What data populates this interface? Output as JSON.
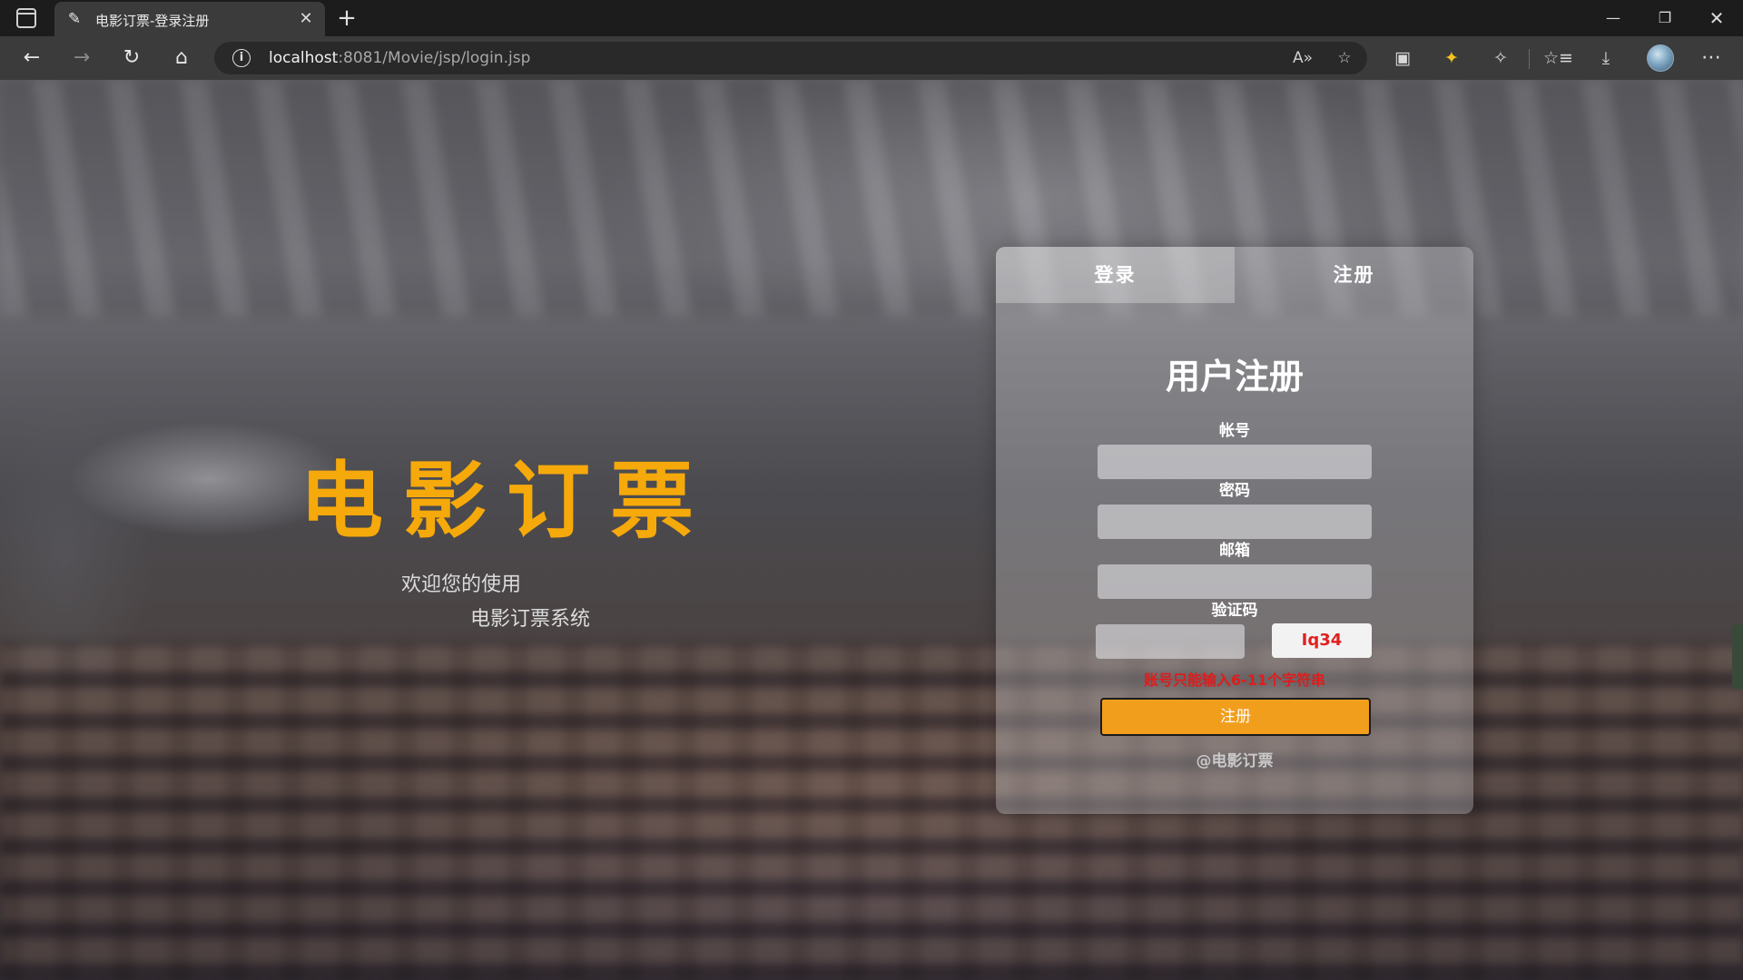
{
  "browser": {
    "tab_title": "电影订票-登录注册",
    "url_host": "localhost",
    "url_rest": ":8081/Movie/jsp/login.jsp",
    "icons": {
      "sidebar": "sidebar-toggle-icon",
      "favicon": "feather-pen-icon",
      "close": "✕",
      "new_tab": "+",
      "back": "←",
      "forward": "→",
      "refresh": "↻",
      "home": "⌂",
      "info": "i",
      "read_aloud": "A»",
      "add_favorite": "☆",
      "ext1": "▣",
      "ext2": "✦",
      "ext3": "✧",
      "favorites": "☆≡",
      "downloads": "⤓",
      "more": "⋯",
      "minimize": "—",
      "maximize": "❐",
      "win_close": "✕"
    }
  },
  "hero": {
    "title": "电影订票",
    "line1": "欢迎您的使用",
    "line2": "电影订票系统",
    "title_color": "#f6a90a"
  },
  "panel": {
    "tabs": [
      "登录",
      "注册"
    ],
    "form_title": "用户注册",
    "labels": {
      "account": "帐号",
      "password": "密码",
      "email": "邮箱",
      "captcha": "验证码"
    },
    "values": {
      "account": "",
      "password": "",
      "email": "",
      "captcha": ""
    },
    "captcha_code": "Iq34",
    "error": "账号只能输入6-11个字符串",
    "submit_label": "注册",
    "footer": "@电影订票",
    "accent": "#f29e1d",
    "error_color": "#e01c1c"
  }
}
